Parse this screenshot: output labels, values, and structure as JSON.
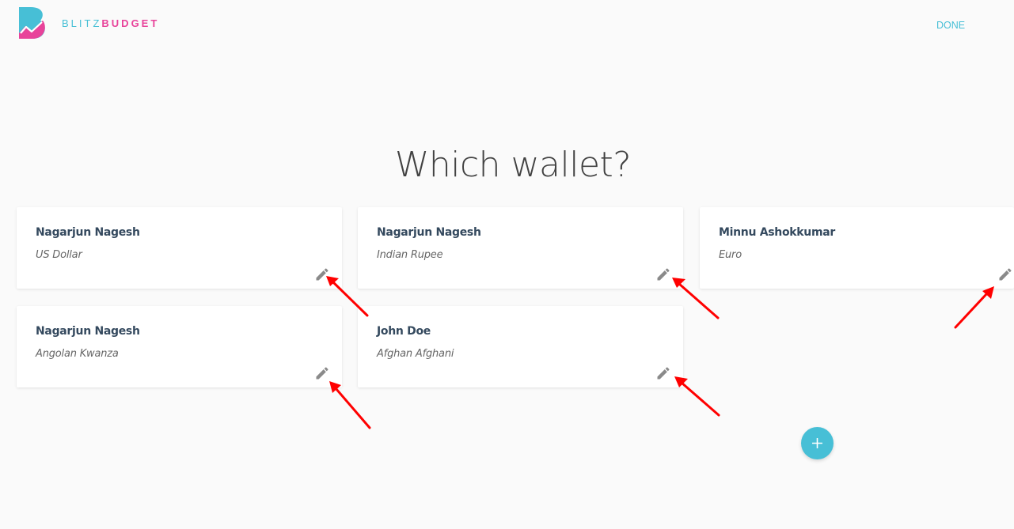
{
  "header": {
    "logo_text_light": "BLITZ",
    "logo_text_bold": "BUDGET",
    "done_label": "DONE"
  },
  "page_title": "Which wallet?",
  "wallets": [
    {
      "owner": "Nagarjun Nagesh",
      "currency": "US Dollar"
    },
    {
      "owner": "Nagarjun Nagesh",
      "currency": "Indian Rupee"
    },
    {
      "owner": "Minnu Ashokkumar",
      "currency": "Euro"
    },
    {
      "owner": "Nagarjun Nagesh",
      "currency": "Angolan Kwanza"
    },
    {
      "owner": "John Doe",
      "currency": "Afghan Afghani"
    }
  ],
  "icons": {
    "edit": "pencil-icon",
    "add": "plus-icon",
    "annotation": "red-arrow"
  },
  "colors": {
    "accent": "#47bfd6",
    "brand_pink": "#e8439a",
    "annotation": "#ff0000"
  }
}
